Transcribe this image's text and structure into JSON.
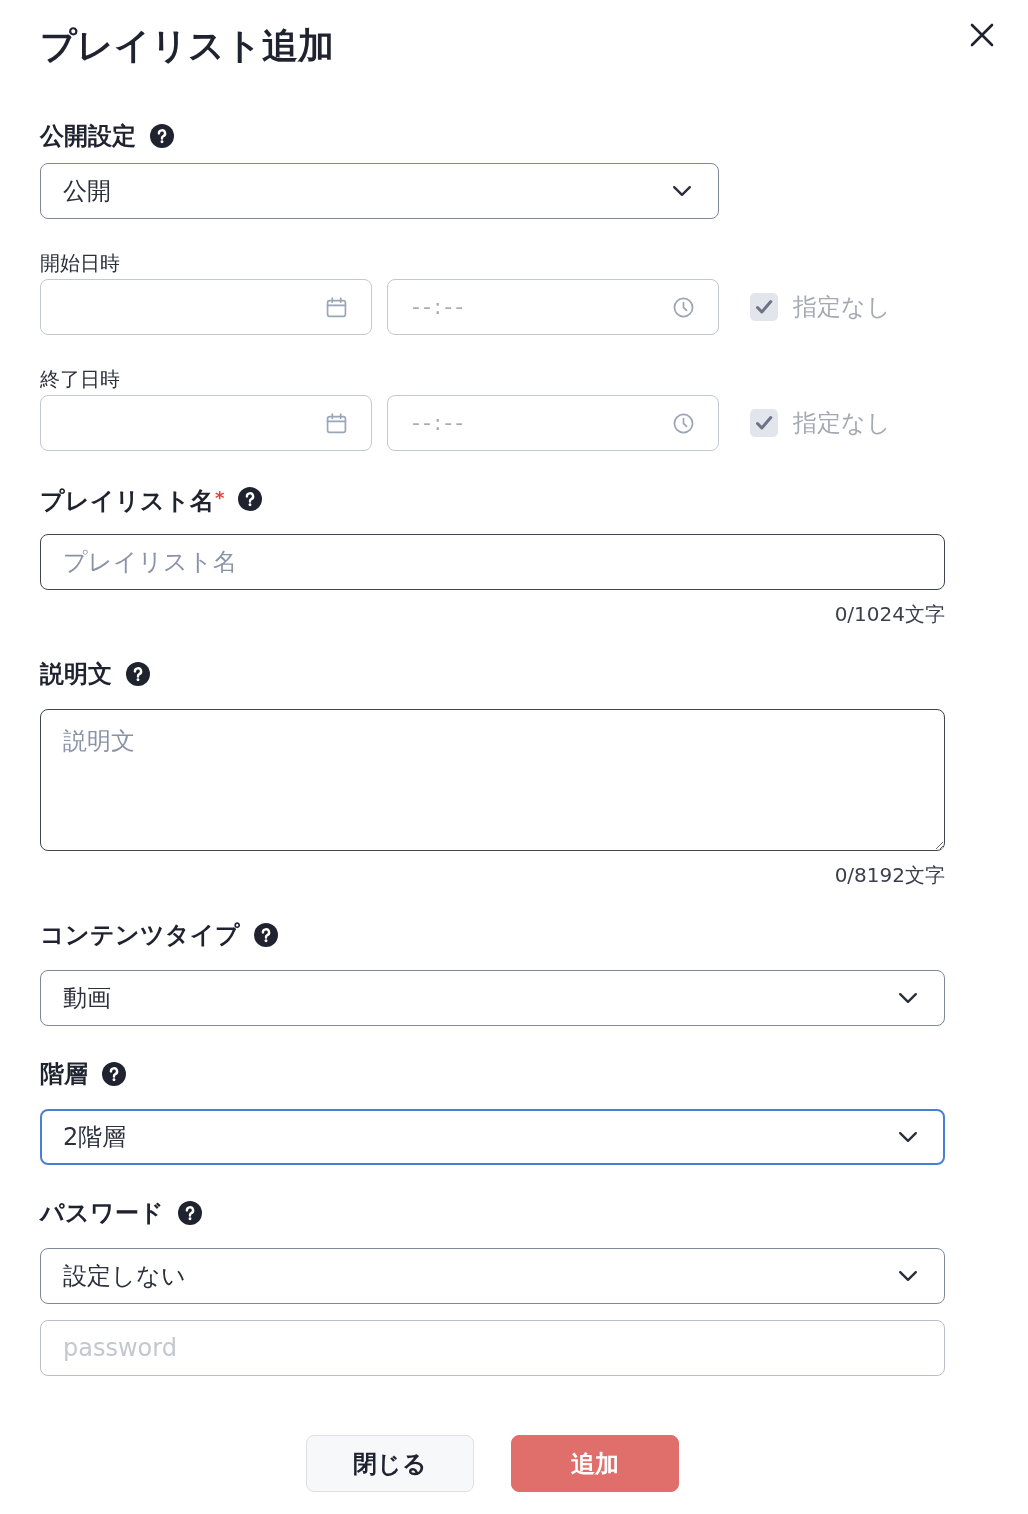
{
  "dialog": {
    "title": "プレイリスト追加"
  },
  "visibility": {
    "label": "公開設定",
    "value": "公開",
    "focused": false,
    "periods": [
      {
        "label": "開始日時",
        "time_placeholder": "--:--",
        "disabled": true,
        "no_limit": {
          "label": "指定なし",
          "checked": true
        }
      },
      {
        "label": "終了日時",
        "time_placeholder": "--:--",
        "disabled": true,
        "no_limit": {
          "label": "指定なし",
          "checked": true
        }
      }
    ]
  },
  "fields": [
    {
      "kind": "text",
      "label": "プレイリスト名",
      "required_mark": "*",
      "placeholder": "プレイリスト名",
      "counter": "0/1024文字"
    },
    {
      "kind": "textarea",
      "label": "説明文",
      "placeholder": "説明文",
      "counter": "0/8192文字"
    },
    {
      "kind": "select",
      "label": "コンテンツタイプ",
      "value": "動画",
      "focused": false
    },
    {
      "kind": "select",
      "label": "階層",
      "value": "2階層",
      "focused": true
    },
    {
      "kind": "select_with_input",
      "label": "パスワード",
      "value": "設定しない",
      "focused": false,
      "placeholder": "password"
    }
  ],
  "buttons": [
    {
      "label": "閉じる",
      "kind": "secondary",
      "disabled": false
    },
    {
      "label": "追加",
      "kind": "primary",
      "disabled": true
    }
  ]
}
